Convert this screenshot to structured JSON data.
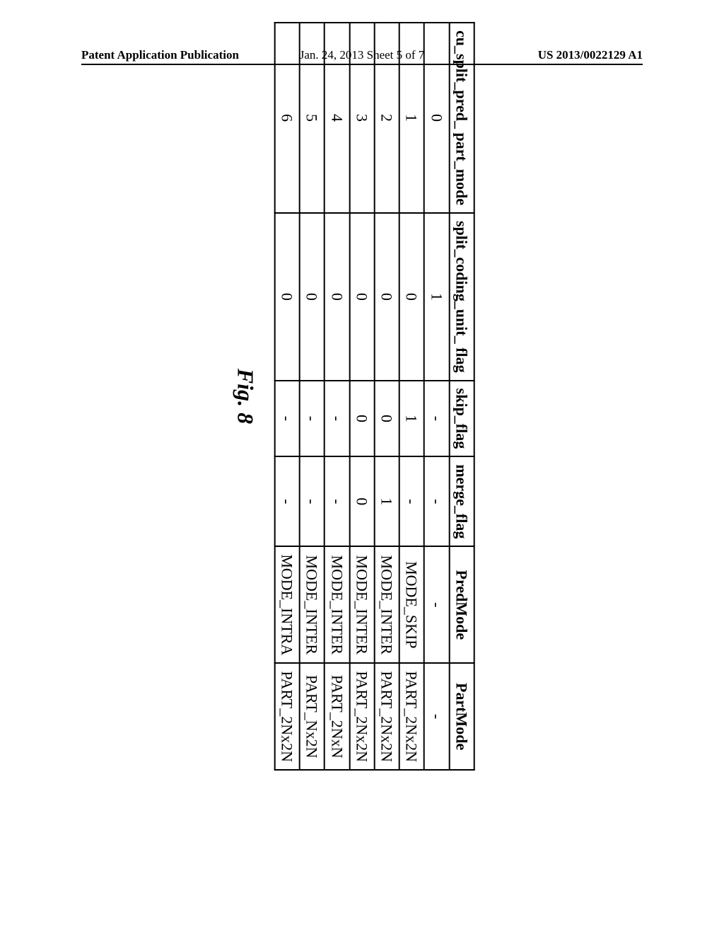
{
  "header": {
    "left": "Patent Application Publication",
    "center": "Jan. 24, 2013  Sheet 5 of 7",
    "right": "US 2013/0022129 A1"
  },
  "figure_label": "Fig. 8",
  "table": {
    "headers": [
      "cu_split_pred_\npart_mode",
      "split_coding_unit_\nflag",
      "skip_flag",
      "merge_flag",
      "PredMode",
      "PartMode"
    ],
    "rows": [
      {
        "c0": "0",
        "c1": "1",
        "c2": "-",
        "c3": "-",
        "c4": "-",
        "c5": "-"
      },
      {
        "c0": "1",
        "c1": "0",
        "c2": "1",
        "c3": "-",
        "c4": "MODE_SKIP",
        "c5": "PART_2Nx2N"
      },
      {
        "c0": "2",
        "c1": "0",
        "c2": "0",
        "c3": "1",
        "c4": "MODE_INTER",
        "c5": "PART_2Nx2N"
      },
      {
        "c0": "3",
        "c1": "0",
        "c2": "0",
        "c3": "0",
        "c4": "MODE_INTER",
        "c5": "PART_2Nx2N"
      },
      {
        "c0": "4",
        "c1": "0",
        "c2": "-",
        "c3": "-",
        "c4": "MODE_INTER",
        "c5": "PART_2NxN"
      },
      {
        "c0": "5",
        "c1": "0",
        "c2": "-",
        "c3": "-",
        "c4": "MODE_INTER",
        "c5": "PART_Nx2N"
      },
      {
        "c0": "6",
        "c1": "0",
        "c2": "-",
        "c3": "-",
        "c4": "MODE_INTRA",
        "c5": "PART_2Nx2N"
      }
    ]
  }
}
